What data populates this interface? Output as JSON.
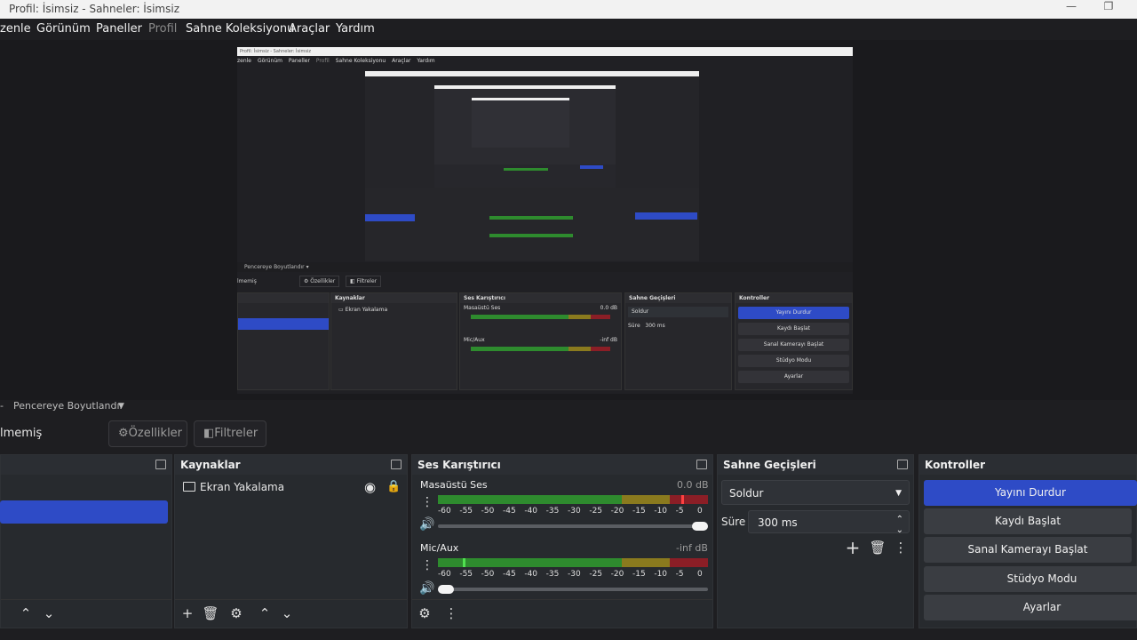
{
  "window": {
    "title": "Profil: İsimsiz - Sahneler: İsimsiz",
    "minimize": "—",
    "maximize": "❐"
  },
  "menu": [
    "zenle",
    "Görünüm",
    "Paneller",
    "Profil",
    "Sahne Koleksiyonu",
    "Araçlar",
    "Yardım"
  ],
  "preview_bar": {
    "label": "Pencereye Boyutlandır"
  },
  "toolbar": {
    "scene_status": "lmemiş",
    "properties": "Özellikler",
    "filters": "Filtreler"
  },
  "docks": {
    "sources": {
      "title": "Kaynaklar",
      "items": [
        {
          "name": "Ekran Yakalama"
        }
      ]
    },
    "mixer": {
      "title": "Ses Karıştırıcı",
      "channels": [
        {
          "name": "Masaüstü Ses",
          "db": "0.0 dB",
          "level": 0.98,
          "volume": 1.0
        },
        {
          "name": "Mic/Aux",
          "db": "-inf dB",
          "level": 0.1,
          "volume": 0.0
        }
      ],
      "ticks": [
        "-60",
        "-55",
        "-50",
        "-45",
        "-40",
        "-35",
        "-30",
        "-25",
        "-20",
        "-15",
        "-10",
        "-5",
        "0"
      ]
    },
    "transitions": {
      "title": "Sahne Geçişleri",
      "selected": "Soldur",
      "duration_label": "Süre",
      "duration": "300 ms"
    },
    "controls": {
      "title": "Kontroller",
      "buttons": [
        "Yayını Durdur",
        "Kaydı Başlat",
        "Sanal Kamerayı Başlat",
        "Stüdyo Modu",
        "Ayarlar"
      ]
    }
  },
  "nested": {
    "title": "Profil: İsimsiz - Sahneler: İsimsiz",
    "menu": [
      "zenle",
      "Görünüm",
      "Paneller",
      "Profil",
      "Sahne Koleksiyonu",
      "Araçlar",
      "Yardım"
    ],
    "bar": "Pencereye Boyutlandır",
    "status": "lmemiş",
    "properties": "Özellikler",
    "filters": "Filtreler",
    "sources_title": "Kaynaklar",
    "source_item": "Ekran Yakalama",
    "mixer_title": "Ses Karıştırıcı",
    "ch1": "Masaüstü Ses",
    "ch1_db": "0.0 dB",
    "ch2": "Mic/Aux",
    "ch2_db": "-inf dB",
    "trans_title": "Sahne Geçişleri",
    "trans_sel": "Soldur",
    "dur_label": "Süre",
    "dur": "300 ms",
    "ctl_title": "Kontroller",
    "ctl_buttons": [
      "Yayını Durdur",
      "Kaydı Başlat",
      "Sanal Kamerayı Başlat",
      "Stüdyo Modu",
      "Ayarlar"
    ]
  },
  "colors": {
    "accent": "#2e4bc6",
    "meter_green": "#2e8b2e",
    "meter_yellow": "#8a7a1e",
    "meter_red": "#8b1e26"
  }
}
